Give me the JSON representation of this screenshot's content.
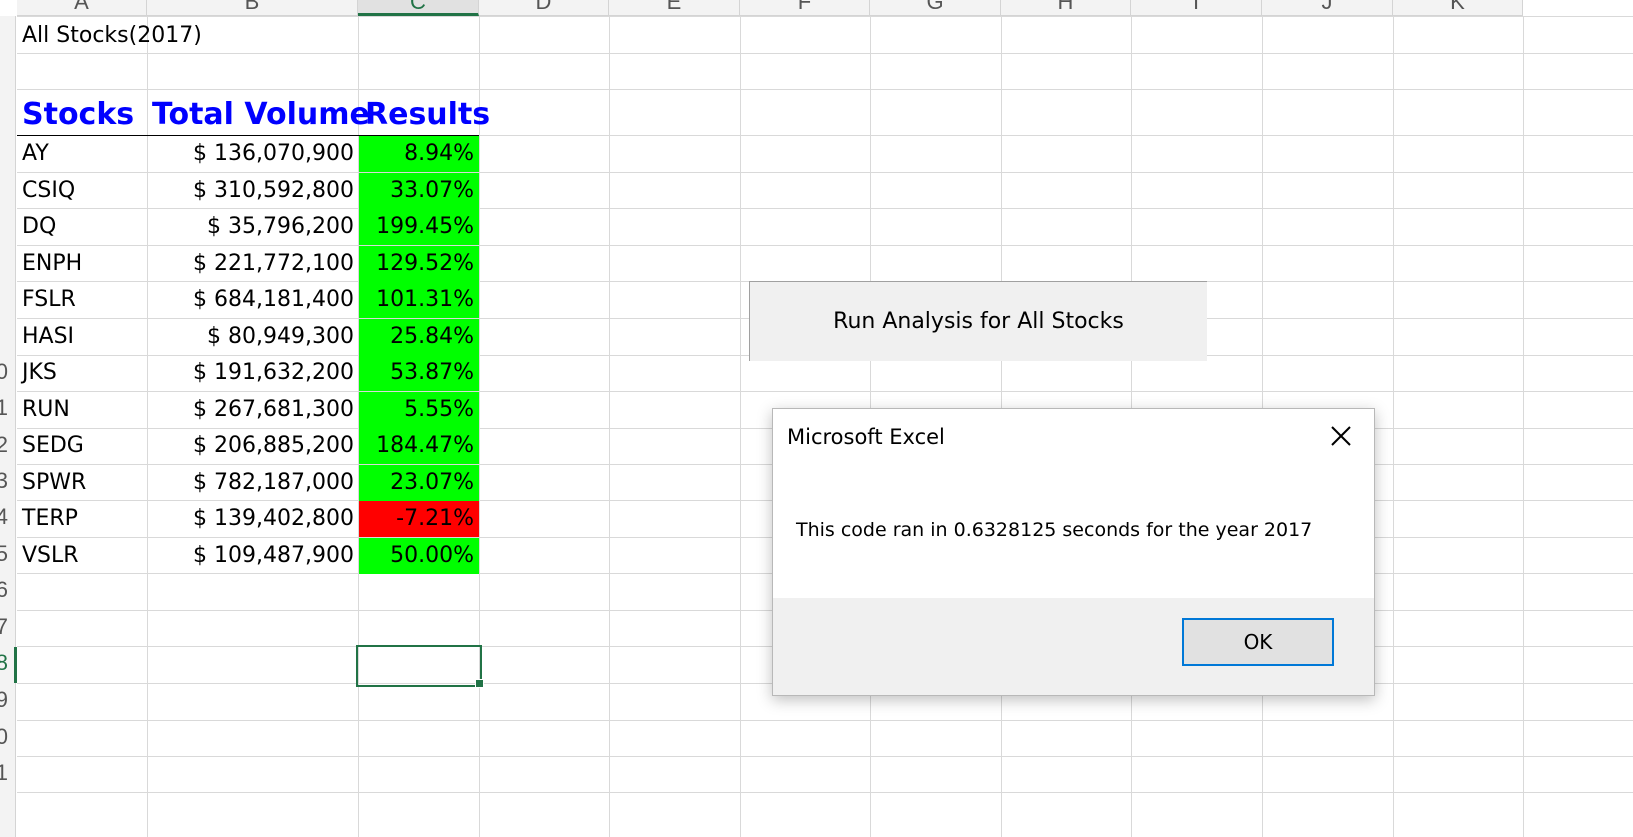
{
  "columns": [
    "A",
    "B",
    "C",
    "D",
    "E",
    "F",
    "G",
    "H",
    "I",
    "J",
    "K"
  ],
  "row_labels": [
    "0",
    "1",
    "2",
    "3",
    "4",
    "5",
    "6",
    "7",
    "8",
    "9",
    "0",
    "1"
  ],
  "sheet": {
    "title": "All Stocks(2017)",
    "headers": {
      "stocks": "Stocks",
      "volume": "Total Volume",
      "results": "Results"
    },
    "rows": [
      {
        "ticker": "AY",
        "volume": "$ 136,070,900",
        "result": "8.94%",
        "positive": true
      },
      {
        "ticker": "CSIQ",
        "volume": "$ 310,592,800",
        "result": "33.07%",
        "positive": true
      },
      {
        "ticker": "DQ",
        "volume": "$ 35,796,200",
        "result": "199.45%",
        "positive": true
      },
      {
        "ticker": "ENPH",
        "volume": "$ 221,772,100",
        "result": "129.52%",
        "positive": true
      },
      {
        "ticker": "FSLR",
        "volume": "$ 684,181,400",
        "result": "101.31%",
        "positive": true
      },
      {
        "ticker": "HASI",
        "volume": "$ 80,949,300",
        "result": "25.84%",
        "positive": true
      },
      {
        "ticker": "JKS",
        "volume": "$ 191,632,200",
        "result": "53.87%",
        "positive": true
      },
      {
        "ticker": "RUN",
        "volume": "$ 267,681,300",
        "result": "5.55%",
        "positive": true
      },
      {
        "ticker": "SEDG",
        "volume": "$ 206,885,200",
        "result": "184.47%",
        "positive": true
      },
      {
        "ticker": "SPWR",
        "volume": "$ 782,187,000",
        "result": "23.07%",
        "positive": true
      },
      {
        "ticker": "TERP",
        "volume": "$ 139,402,800",
        "result": "-7.21%",
        "positive": false
      },
      {
        "ticker": "VSLR",
        "volume": "$ 109,487,900",
        "result": "50.00%",
        "positive": true
      }
    ],
    "colors": {
      "positive": "#00ff00",
      "negative": "#ff0000",
      "header_text": "#0000ff",
      "selection": "#217346"
    }
  },
  "run_button": {
    "label": "Run Analysis for All Stocks"
  },
  "dialog": {
    "title": "Microsoft Excel",
    "message": "This code ran in 0.6328125 seconds for the year 2017",
    "ok_label": "OK",
    "close_icon": "close-icon"
  }
}
